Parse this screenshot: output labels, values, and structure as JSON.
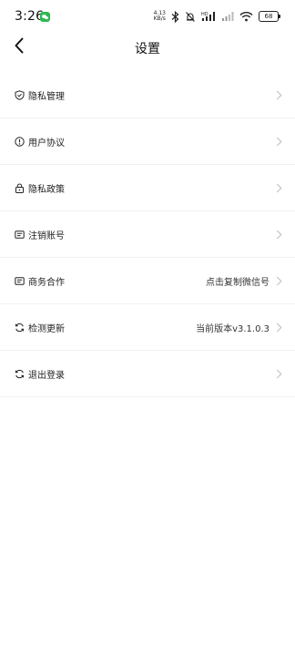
{
  "status_bar": {
    "time": "3:26",
    "net_speed_value": "4.13",
    "net_speed_unit": "KB/s",
    "battery": "68"
  },
  "nav": {
    "title": "设置"
  },
  "settings": [
    {
      "label": "隐私管理",
      "value": "",
      "icon": "shield-icon"
    },
    {
      "label": "用户协议",
      "value": "",
      "icon": "info-circle-icon"
    },
    {
      "label": "隐私政策",
      "value": "",
      "icon": "lock-icon"
    },
    {
      "label": "注销账号",
      "value": "",
      "icon": "id-card-icon"
    },
    {
      "label": "商务合作",
      "value": "点击复制微信号",
      "icon": "id-card-icon"
    },
    {
      "label": "检测更新",
      "value": "当前版本v3.1.0.3",
      "icon": "refresh-icon"
    },
    {
      "label": "退出登录",
      "value": "",
      "icon": "refresh-icon"
    }
  ],
  "colors": {
    "text": "#222222",
    "chevron": "#c4c4c4",
    "divider": "#f2f2f2",
    "wechat": "#2fb84f"
  }
}
